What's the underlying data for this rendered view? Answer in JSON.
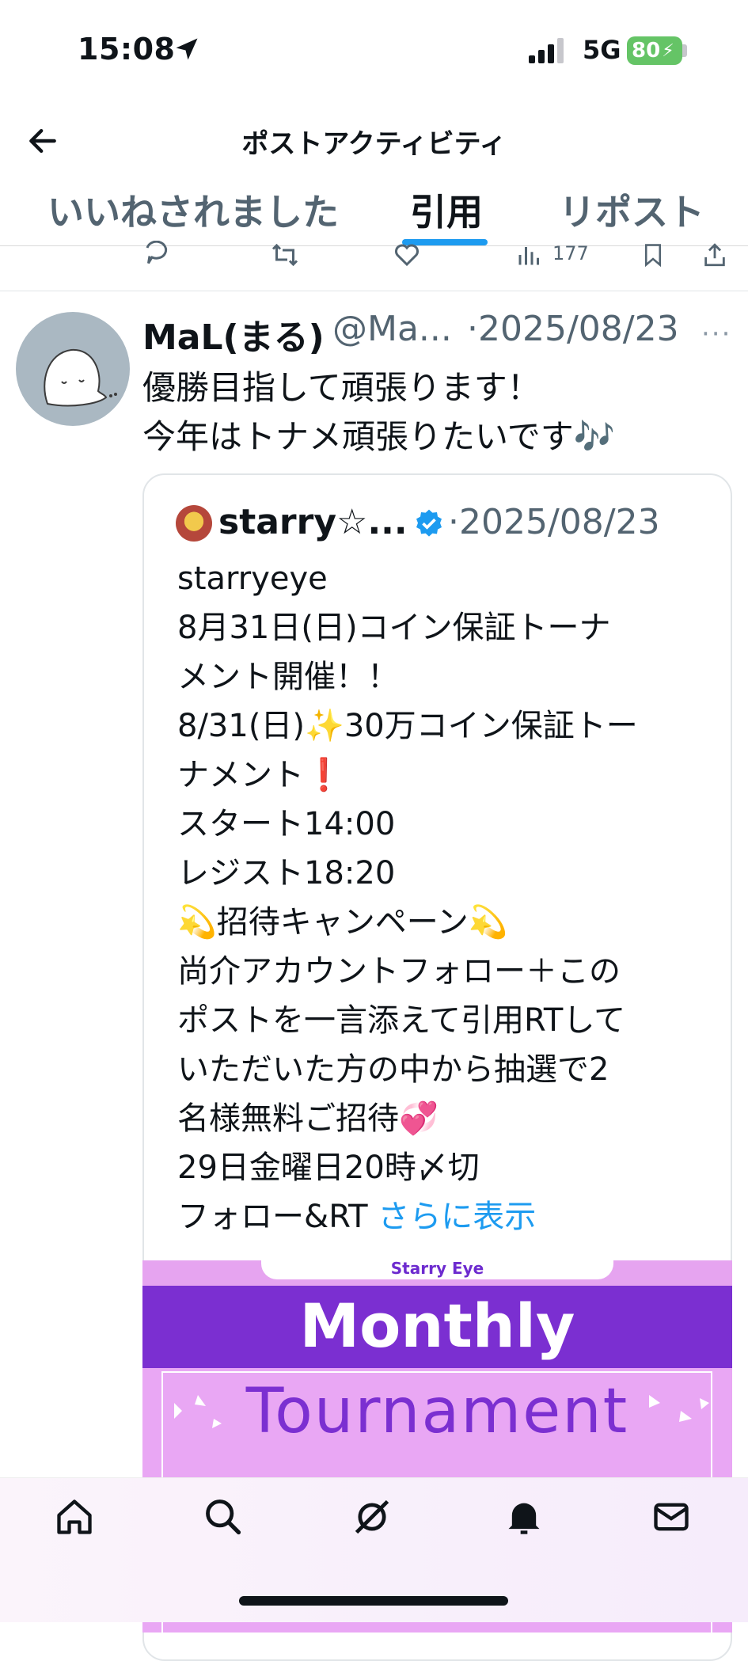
{
  "status_bar": {
    "time": "15:08",
    "network": "5G",
    "battery": "80"
  },
  "header": {
    "title": "ポストアクティビティ"
  },
  "tabs": [
    {
      "label": "いいねされました"
    },
    {
      "label": "引用"
    },
    {
      "label": "リポスト"
    }
  ],
  "prev_post": {
    "view_count": "177"
  },
  "post": {
    "author_name": "MaL(まる)",
    "author_handle": "@Ma...",
    "date": "·2025/08/23",
    "more": "···",
    "text_lines": [
      "優勝目指して頑張ります！",
      "今年はトナメ頑張りたいです🎶"
    ]
  },
  "quote": {
    "author_name": "starry☆...",
    "date": "·2025/08/23",
    "lines": [
      "starryeye",
      "8月31日(日)コイン保証トーナ",
      "メント開催！！",
      "8/31(日)✨30万コイン保証トー",
      "ナメント❗",
      "スタート14:00",
      "レジスト18:20",
      "💫招待キャンペーン💫",
      "尚介アカウントフォロー＋この",
      "ポストを一言添えて引用RTして",
      "いただいた方の中から抽選で2",
      "名様無料ご招待💞",
      "29日金曜日20時〆切",
      "フォロー&RT"
    ],
    "show_more": "さらに表示",
    "image": {
      "top_label": "Starry Eye",
      "title": "Monthly",
      "subtitle": "Tournament"
    }
  },
  "colors": {
    "accent": "#1d9bf0",
    "purple": "#7b2fd1",
    "pink": "#e9a7f4"
  },
  "bottom_nav": {
    "icons": [
      "home-icon",
      "search-icon",
      "grok-icon",
      "notifications-icon",
      "messages-icon"
    ]
  }
}
